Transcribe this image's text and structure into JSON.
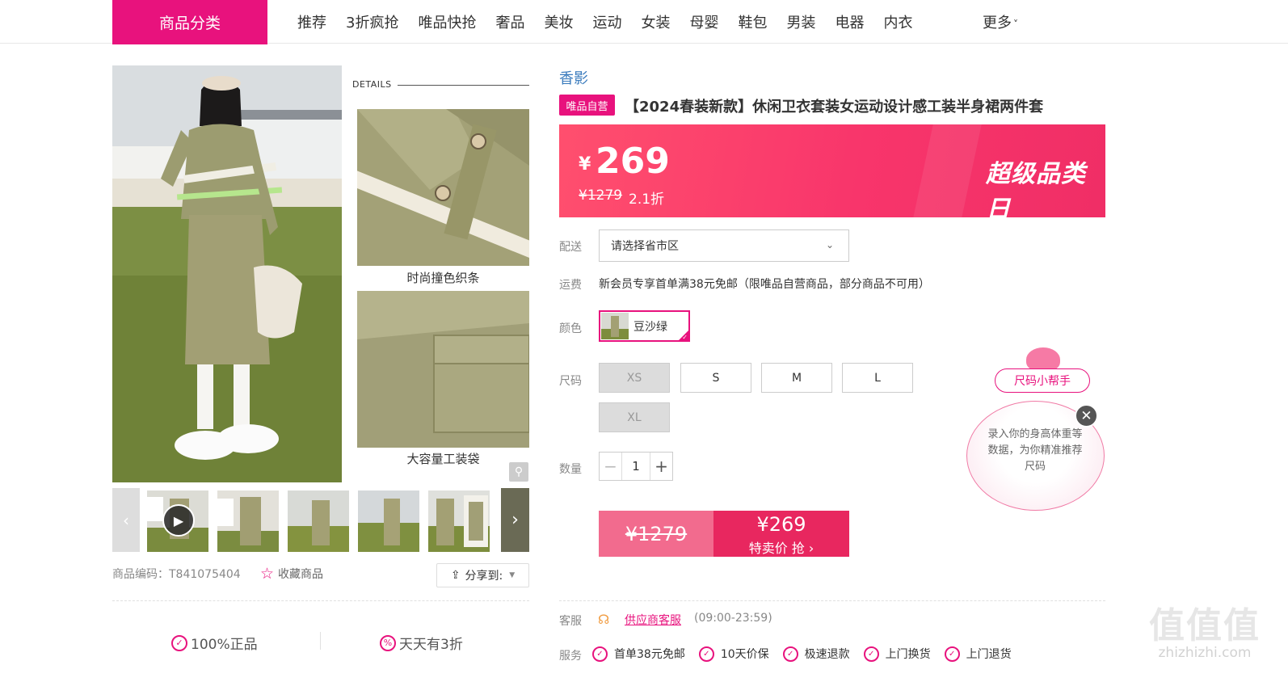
{
  "nav": {
    "category_button": "商品分类",
    "items": [
      "推荐",
      "3折疯抢",
      "唯品快抢",
      "奢品",
      "美妆",
      "运动",
      "女装",
      "母婴",
      "鞋包",
      "男装",
      "电器",
      "内衣"
    ],
    "more": "更多"
  },
  "gallery": {
    "details_heading": "DETAILS",
    "caption_1": "时尚撞色织条",
    "caption_2": "大容量工装袋",
    "thumb_count": 6
  },
  "meta": {
    "product_code": "商品编码：T841075404",
    "favorite": "收藏商品",
    "share": "分享到:"
  },
  "guarantees": {
    "genuine": "100%正品",
    "daily_discount": "天天有3折"
  },
  "product": {
    "brand": "香影",
    "self_badge": "唯品自营",
    "title": "【2024春装新款】休闲卫衣套装女运动设计感工装半身裙两件套",
    "currency": "¥",
    "price": "269",
    "original_price": "¥1279",
    "discount": "2.1折",
    "promo": "超级品类日"
  },
  "options": {
    "delivery_label": "配送",
    "delivery_placeholder": "请选择省市区",
    "freight_label": "运费",
    "freight_text": "新会员专享首单满38元免邮（限唯品自营商品，部分商品不可用）",
    "color_label": "颜色",
    "color_value": "豆沙绿",
    "size_label": "尺码",
    "sizes": [
      "XS",
      "S",
      "M",
      "L",
      "XL"
    ],
    "qty_label": "数量",
    "qty_value": "1"
  },
  "buy": {
    "original": "¥1279",
    "price": "¥269",
    "action": "特卖价 抢 ›"
  },
  "helper": {
    "pill": "尺码小帮手",
    "text": "录入你的身高体重等数据，为你精准推荐尺码"
  },
  "service": {
    "kf_label": "客服",
    "kf_link": "供应商客服",
    "kf_hours": "(09:00-23:59)",
    "svc_label": "服务",
    "items": [
      "首单38元免邮",
      "10天价保",
      "极速退款",
      "上门换货",
      "上门退货"
    ]
  },
  "watermark": {
    "line1": "值值值",
    "line2": "zhizhizhi.com"
  },
  "colors": {
    "brand_pink": "#e8127d",
    "price_red": "#f8356b",
    "link_blue": "#3a7bbd"
  }
}
